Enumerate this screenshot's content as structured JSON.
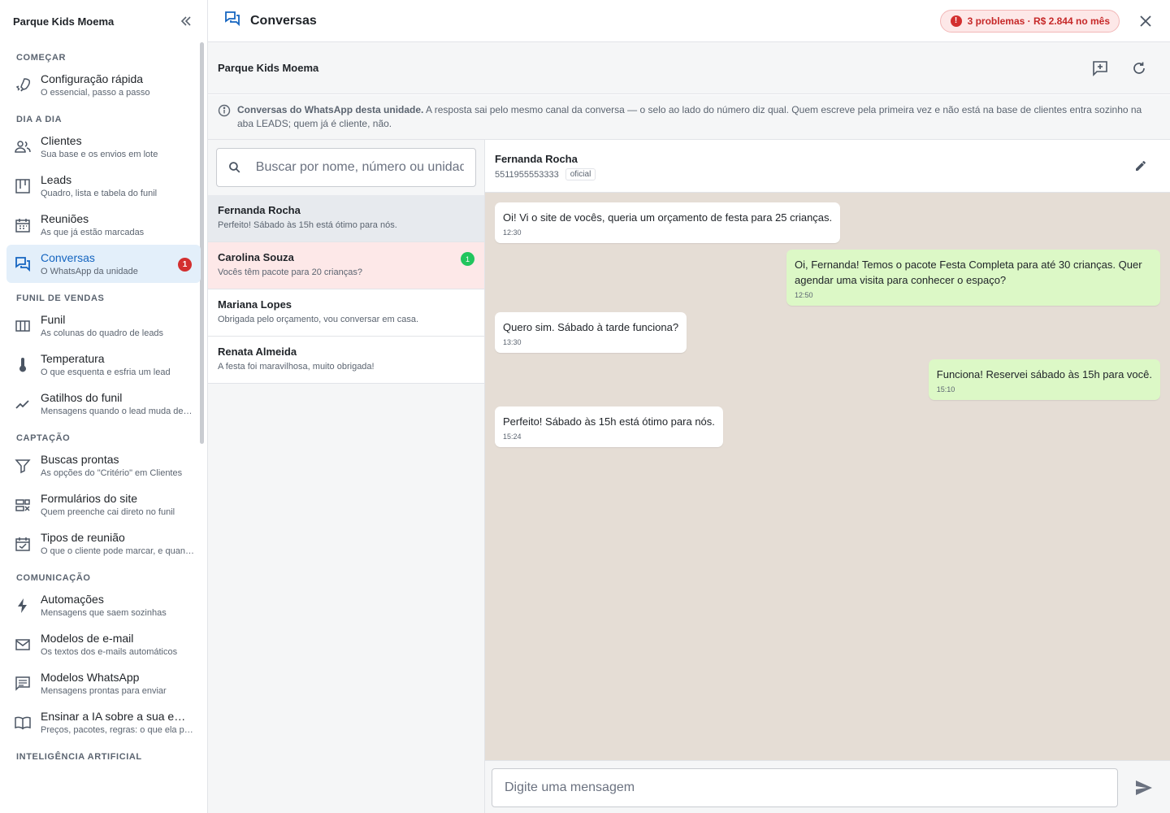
{
  "sidebar": {
    "title": "Parque Kids Moema",
    "sections": [
      {
        "title": "COMEÇAR",
        "items": [
          {
            "label": "Configuração rápida",
            "sub": "O essencial, passo a passo",
            "icon": "rocket-icon"
          }
        ]
      },
      {
        "title": "DIA A DIA",
        "items": [
          {
            "label": "Clientes",
            "sub": "Sua base e os envios em lote",
            "icon": "people-icon"
          },
          {
            "label": "Leads",
            "sub": "Quadro, lista e tabela do funil",
            "icon": "kanban-icon"
          },
          {
            "label": "Reuniões",
            "sub": "As que já estão marcadas",
            "icon": "calendar-icon"
          },
          {
            "label": "Conversas",
            "sub": "O WhatsApp da unidade",
            "icon": "chat-icon",
            "badge": "1",
            "active": true
          }
        ]
      },
      {
        "title": "FUNIL DE VENDAS",
        "items": [
          {
            "label": "Funil",
            "sub": "As colunas do quadro de leads",
            "icon": "columns-icon"
          },
          {
            "label": "Temperatura",
            "sub": "O que esquenta e esfria um lead",
            "icon": "thermometer-icon"
          },
          {
            "label": "Gatilhos do funil",
            "sub": "Mensagens quando o lead muda de etapa",
            "icon": "trend-icon"
          }
        ]
      },
      {
        "title": "CAPTAÇÃO",
        "items": [
          {
            "label": "Buscas prontas",
            "sub": "As opções do \"Critério\" em Clientes",
            "icon": "filter-icon"
          },
          {
            "label": "Formulários do site",
            "sub": "Quem preenche cai direto no funil",
            "icon": "form-icon"
          },
          {
            "label": "Tipos de reunião",
            "sub": "O que o cliente pode marcar, e quando",
            "icon": "event-icon"
          }
        ]
      },
      {
        "title": "COMUNICAÇÃO",
        "items": [
          {
            "label": "Automações",
            "sub": "Mensagens que saem sozinhas",
            "icon": "bolt-icon"
          },
          {
            "label": "Modelos de e-mail",
            "sub": "Os textos dos e-mails automáticos",
            "icon": "mail-icon"
          },
          {
            "label": "Modelos WhatsApp",
            "sub": "Mensagens prontas para enviar",
            "icon": "message-icon"
          },
          {
            "label": "Ensinar a IA sobre a sua empresa",
            "sub": "Preços, pacotes, regras: o que ela precisa saber",
            "icon": "book-icon"
          }
        ]
      },
      {
        "title": "INTELIGÊNCIA ARTIFICIAL",
        "items": []
      }
    ]
  },
  "topbar": {
    "title": "Conversas",
    "problems": "3 problemas · R$ 2.844 no mês"
  },
  "unit": {
    "name": "Parque Kids Moema"
  },
  "info": {
    "bold": "Conversas do WhatsApp desta unidade.",
    "text": " A resposta sai pelo mesmo canal da conversa — o selo ao lado do número diz qual. Quem escreve pela primeira vez e não está na base de clientes entra sozinho na aba LEADS; quem já é cliente, não."
  },
  "search": {
    "placeholder": "Buscar por nome, número ou unidade"
  },
  "conversations": [
    {
      "name": "Fernanda Rocha",
      "preview": "Perfeito! Sábado às 15h está ótimo para nós.",
      "state": "selected"
    },
    {
      "name": "Carolina Souza",
      "preview": "Vocês têm pacote para 20 crianças?",
      "state": "unread",
      "badge": "1"
    },
    {
      "name": "Mariana Lopes",
      "preview": "Obrigada pelo orçamento, vou conversar em casa.",
      "state": ""
    },
    {
      "name": "Renata Almeida",
      "preview": "A festa foi maravilhosa, muito obrigada!",
      "state": ""
    }
  ],
  "chat": {
    "name": "Fernanda Rocha",
    "phone": "5511955553333",
    "tag": "oficial",
    "messages": [
      {
        "dir": "in",
        "text": "Oi! Vi o site de vocês, queria um orçamento de festa para 25 crianças.",
        "time": "12:30"
      },
      {
        "dir": "out",
        "text": "Oi, Fernanda! Temos o pacote Festa Completa para até 30 crianças. Quer agendar uma visita para conhecer o espaço?",
        "time": "12:50"
      },
      {
        "dir": "in",
        "text": "Quero sim. Sábado à tarde funciona?",
        "time": "13:30"
      },
      {
        "dir": "out",
        "text": "Funciona! Reservei sábado às 15h para você.",
        "time": "15:10"
      },
      {
        "dir": "in",
        "text": "Perfeito! Sábado às 15h está ótimo para nós.",
        "time": "15:24"
      }
    ]
  },
  "composer": {
    "placeholder": "Digite uma mensagem"
  },
  "colors": {
    "accent": "#1565c0",
    "danger": "#d32f2f",
    "incoming_bubble": "#ffffff",
    "outgoing_bubble": "#dcf8c6",
    "chat_bg": "#e5ddd5"
  }
}
